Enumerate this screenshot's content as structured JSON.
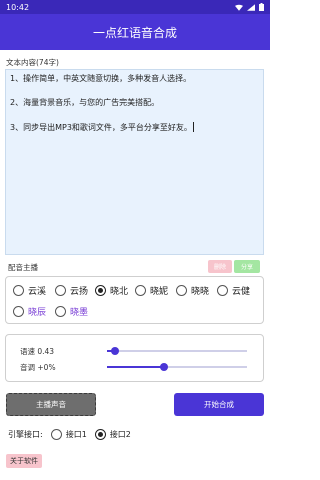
{
  "status_bar": {
    "time": "10:42"
  },
  "app_bar": {
    "title": "一点红语音合成"
  },
  "text_section": {
    "label": "文本内容(74字)",
    "lines": [
      "1、操作简单，中英文随意切换，多种发音人选择。",
      "2、海量背景音乐，与您的广告完美搭配。",
      "3、同步导出MP3和歌词文件，多平台分享至好友。"
    ]
  },
  "voice_section": {
    "label": "配音主播",
    "delete_label": "删除",
    "share_label": "分享",
    "selected": "晓北",
    "options": [
      "云溪",
      "云扬",
      "晓北",
      "晓妮",
      "晓晓",
      "云健",
      "晓辰",
      "晓墨"
    ]
  },
  "sliders": {
    "speed_label": "语速 0.43",
    "speed_value": 0.43,
    "pitch_label": "音调 +0%",
    "pitch_value": 0
  },
  "buttons": {
    "anchor_voice": "主播声音",
    "start_synthesis": "开始合成"
  },
  "engine": {
    "label": "引擎接口:",
    "options": [
      "接口1",
      "接口2"
    ],
    "selected": "接口2"
  },
  "about_label": "关于软件",
  "colors": {
    "primary": "#4a35d6",
    "status": "#3a28b8",
    "accent_purple": "#7a3fd6"
  }
}
